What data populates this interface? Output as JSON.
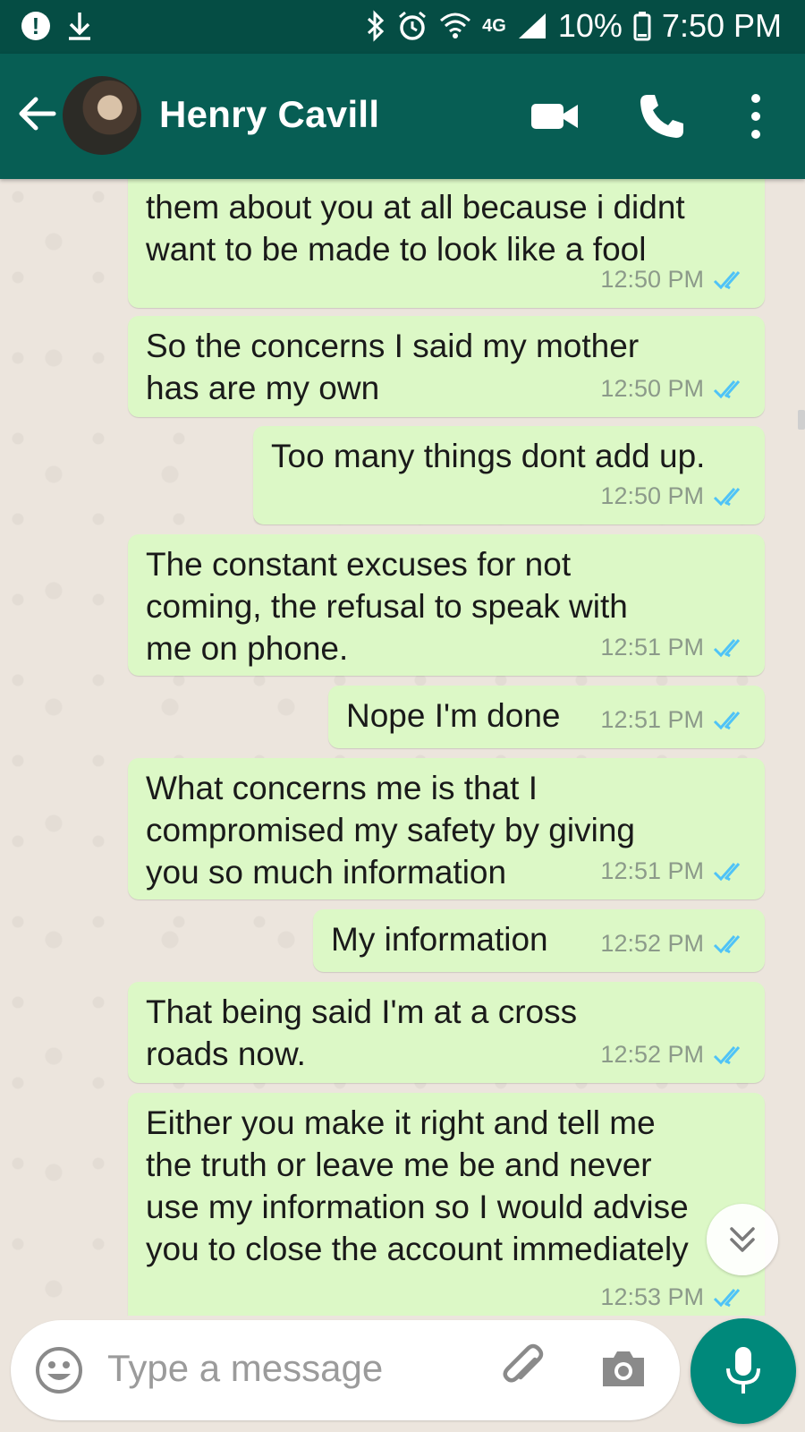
{
  "status_bar": {
    "network": "4G",
    "battery": "10%",
    "time": "7:50 PM"
  },
  "header": {
    "contact_name": "Henry Cavill"
  },
  "messages": [
    {
      "text": "them about you at all because i didnt\nwant to be made to look like a fool",
      "time": "12:50 PM"
    },
    {
      "text": "So the concerns I said my mother\nhas are my own",
      "time": "12:50 PM"
    },
    {
      "text": "Too many things dont add up.",
      "time": "12:50 PM"
    },
    {
      "text": "The constant excuses for not\ncoming, the refusal to speak with\nme on phone.",
      "time": "12:51 PM"
    },
    {
      "text": "Nope I'm done",
      "time": "12:51 PM"
    },
    {
      "text": "What concerns me is that I\ncompromised my safety by giving\nyou so much information",
      "time": "12:51 PM"
    },
    {
      "text": "My information",
      "time": "12:52 PM"
    },
    {
      "text": "That being said I'm at a cross\nroads now.",
      "time": "12:52 PM"
    },
    {
      "text": "Either you make it right and tell me\nthe truth or leave me be and never\nuse my information so I would advise\nyou to close the account immediately",
      "time": "12:53 PM"
    }
  ],
  "input": {
    "placeholder": "Type a message"
  },
  "colors": {
    "header": "#075E54",
    "status_bar": "#054D44",
    "bubble": "#DCF8C6",
    "read_ticks": "#4FC3F7",
    "mic_button": "#00897B"
  }
}
